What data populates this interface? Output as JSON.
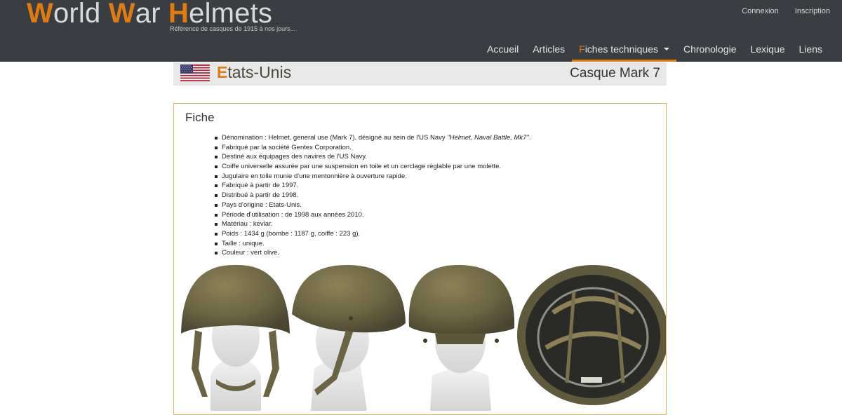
{
  "header": {
    "logo": {
      "w1_initial": "W",
      "w1_rest": "orld ",
      "w2_initial": "W",
      "w2_rest": "ar ",
      "w3_initial": "H",
      "w3_rest": "elmets"
    },
    "tagline": "Référence de casques de 1915 à nos jours...",
    "auth": {
      "login": "Connexion",
      "register": "Inscription"
    },
    "nav": {
      "home": "Accueil",
      "articles": "Articles",
      "fiches_initial": "F",
      "fiches_rest": "iches techniques",
      "chronology": "Chronologie",
      "lexicon": "Lexique",
      "links": "Liens"
    },
    "accent_color": "#e07b10"
  },
  "country_bar": {
    "country_initial": "E",
    "country_rest": "tats-Unis",
    "model": "Casque Mark 7",
    "flag_icon": "us-flag-icon"
  },
  "card": {
    "title": "Fiche",
    "specs": {
      "denomination_prefix": "Dénomination : Helmet, general use (Mark 7), désigné au sein de l'US Navy ",
      "denomination_em": "\"Helmet, Naval Battle, Mk7\"",
      "denomination_suffix": ".",
      "items": [
        "Fabriqué par la société Gentex Corporation.",
        "Destiné aux équipages des navires de l'US Navy.",
        "Coiffe universelle assurée par une suspension en toile et un cerclage réglable par une molette.",
        "Jugulaire en toile munie d'une mentonnière à ouverture rapide.",
        "Fabriqué à partir de 1997.",
        "Distribué à partir de 1998.",
        "Pays d'origine : Etats-Unis.",
        "Période d'utilisation : de 1998 aux années 2010.",
        "Matériau : kevlar.",
        "Poids : 1434 g (bombe : 1187 g, coiffe : 223 g).",
        "Taille : unique.",
        "Couleur : vert olive."
      ]
    },
    "photos": [
      "front-view",
      "side-view",
      "back-view",
      "interior-view"
    ]
  }
}
